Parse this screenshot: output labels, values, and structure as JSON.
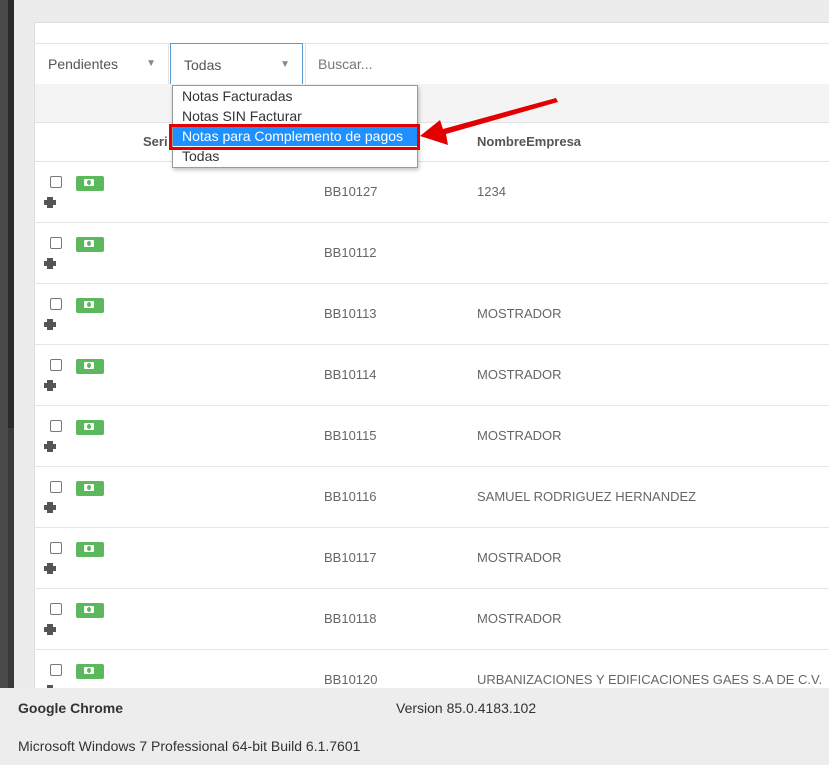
{
  "filters": {
    "status_select": "Pendientes",
    "type_select": "Todas",
    "search_placeholder": "Buscar..."
  },
  "dropdown": {
    "options": [
      "Notas Facturadas",
      "Notas SIN Facturar",
      "Notas para Complemento de pagos",
      "Todas"
    ],
    "highlighted_index": 2
  },
  "table": {
    "columns": [
      "Seri",
      "NombreEmpresa"
    ],
    "rows": [
      {
        "serie": "BB10127",
        "empresa": "1234"
      },
      {
        "serie": "BB10112",
        "empresa": ""
      },
      {
        "serie": "BB10113",
        "empresa": "MOSTRADOR"
      },
      {
        "serie": "BB10114",
        "empresa": "MOSTRADOR"
      },
      {
        "serie": "BB10115",
        "empresa": "MOSTRADOR"
      },
      {
        "serie": "BB10116",
        "empresa": "SAMUEL RODRIGUEZ HERNANDEZ"
      },
      {
        "serie": "BB10117",
        "empresa": "MOSTRADOR"
      },
      {
        "serie": "BB10118",
        "empresa": "MOSTRADOR"
      },
      {
        "serie": "BB10120",
        "empresa": "URBANIZACIONES Y EDIFICACIONES GAES S.A DE C.V."
      }
    ]
  },
  "footer": {
    "browser": "Google Chrome",
    "version": "Version 85.0.4183.102",
    "os": "Microsoft Windows 7 Professional  64-bit Build 6.1.7601"
  },
  "colors": {
    "accent": "#1e90ff",
    "highlight_border": "#e30000",
    "money_icon": "#5cb85c"
  }
}
